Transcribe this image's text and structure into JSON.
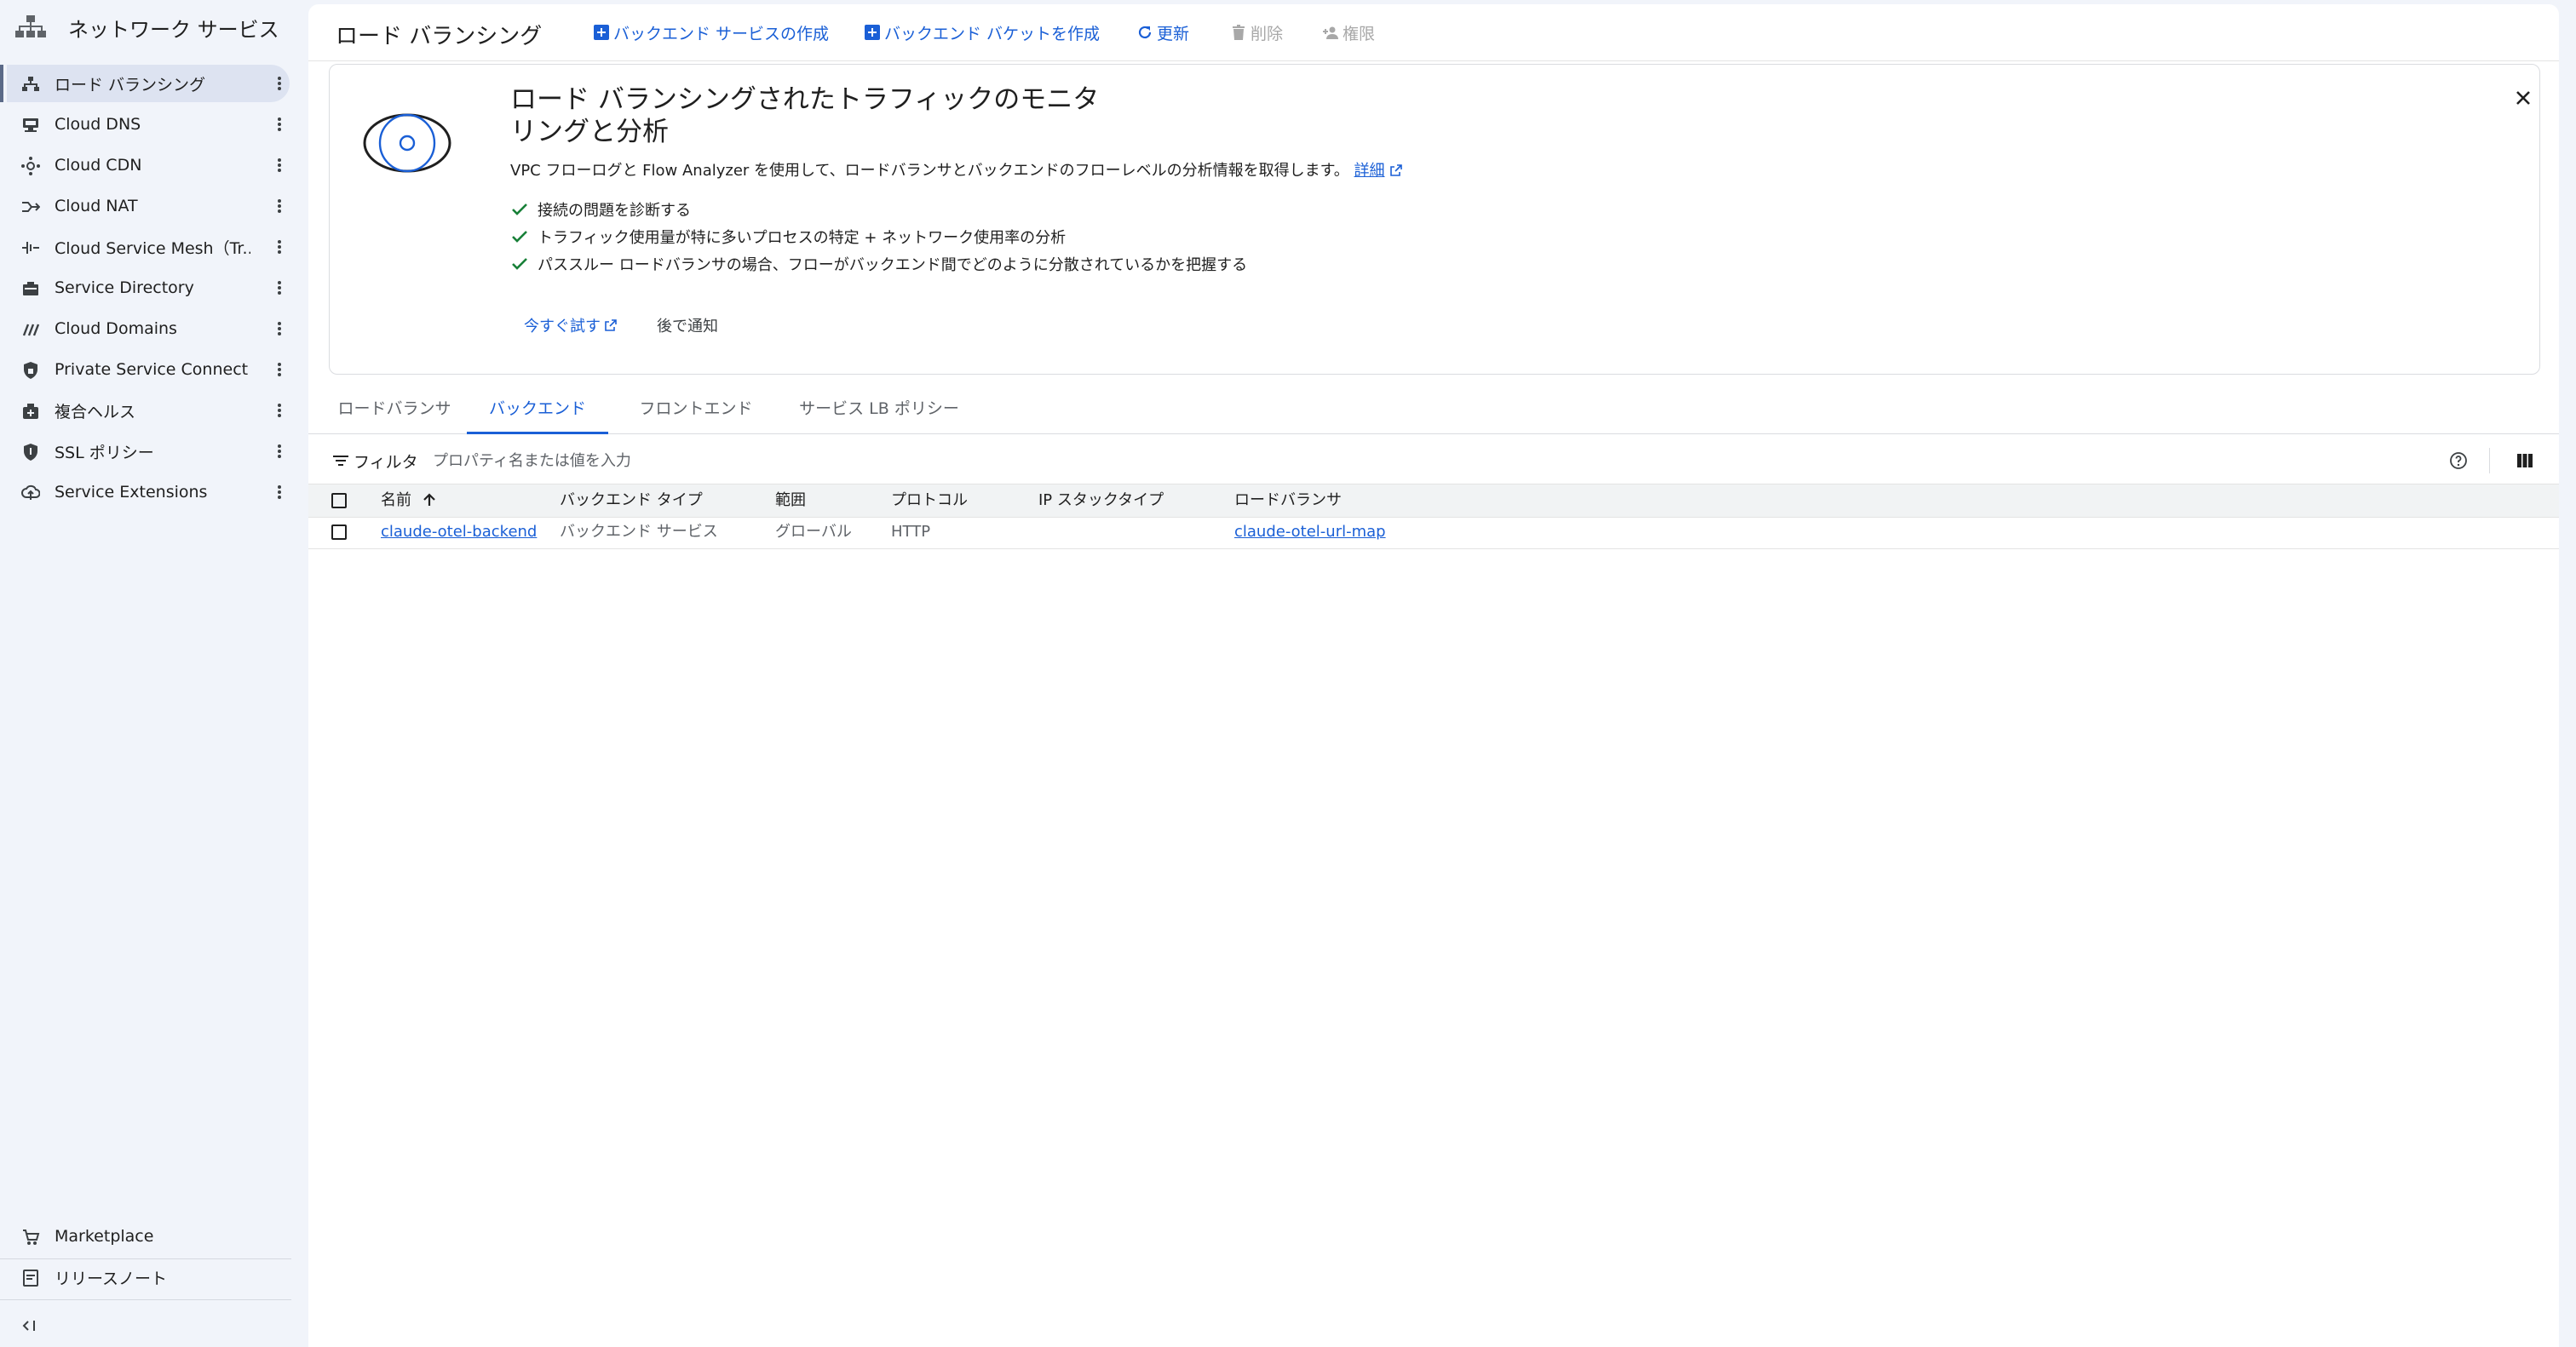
{
  "colors": {
    "accent": "#1a5fd6",
    "success": "#188038",
    "sidebar_bg": "#f1f4fa",
    "active_item_bg": "#dde3f1"
  },
  "sidebar": {
    "title": "ネットワーク サービス",
    "title_icon": "network-services-icon",
    "items": [
      {
        "label": "ロード バランシング",
        "icon": "load-balancing-icon",
        "active": true
      },
      {
        "label": "Cloud DNS",
        "icon": "dns-icon"
      },
      {
        "label": "Cloud CDN",
        "icon": "cdn-icon"
      },
      {
        "label": "Cloud NAT",
        "icon": "nat-icon"
      },
      {
        "label": "Cloud Service Mesh（Tr...",
        "icon": "service-mesh-icon"
      },
      {
        "label": "Service Directory",
        "icon": "service-directory-icon"
      },
      {
        "label": "Cloud Domains",
        "icon": "domains-icon"
      },
      {
        "label": "Private Service Connect",
        "icon": "private-service-connect-icon"
      },
      {
        "label": "複合ヘルス",
        "icon": "composite-health-icon"
      },
      {
        "label": "SSL ポリシー",
        "icon": "ssl-policy-icon"
      },
      {
        "label": "Service Extensions",
        "icon": "service-extensions-icon"
      }
    ],
    "bottom": {
      "marketplace": "Marketplace",
      "release_notes": "リリースノート"
    }
  },
  "toolbar": {
    "title": "ロード バランシング",
    "create_backend_service": "バックエンド サービスの作成",
    "create_backend_bucket": "バックエンド バケットを作成",
    "refresh": "更新",
    "delete": "削除",
    "permissions": "権限"
  },
  "banner": {
    "title": "ロード バランシングされたトラフィックのモニタリングと分析",
    "description": "VPC フローログと Flow Analyzer を使用して、ロードバランサとバックエンドのフローレベルの分析情報を取得します。",
    "details_link": "詳細",
    "bullets": [
      "接続の問題を診断する",
      "トラフィック使用量が特に多いプロセスの特定 + ネットワーク使用率の分析",
      "パススルー ロードバランサの場合、フローがバックエンド間でどのように分散されているかを把握する"
    ],
    "try_now": "今すぐ試す",
    "remind_later": "後で通知"
  },
  "tabs": [
    {
      "label": "ロードバランサ"
    },
    {
      "label": "バックエンド",
      "active": true
    },
    {
      "label": "フロントエンド"
    },
    {
      "label": "サービス LB ポリシー"
    }
  ],
  "filter": {
    "label": "フィルタ",
    "placeholder": "プロパティ名または値を入力",
    "value": ""
  },
  "table": {
    "columns": [
      "名前",
      "バックエンド タイプ",
      "範囲",
      "プロトコル",
      "IP スタックタイプ",
      "ロードバランサ"
    ],
    "sort": {
      "column": "名前",
      "direction": "ascending"
    },
    "rows": [
      {
        "name": "claude-otel-backend",
        "backend_type": "バックエンド サービス",
        "scope": "グローバル",
        "protocol": "HTTP",
        "ip_stack_type": "",
        "load_balancer": "claude-otel-url-map"
      }
    ]
  }
}
